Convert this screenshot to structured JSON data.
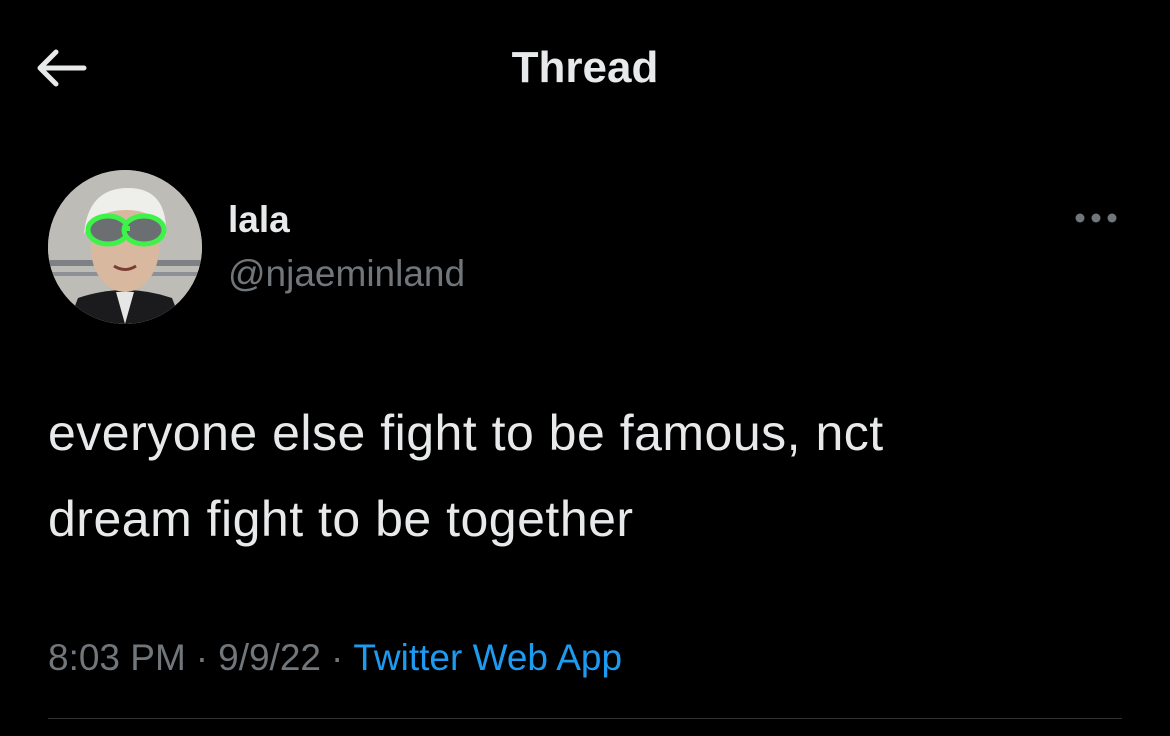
{
  "header": {
    "title": "Thread"
  },
  "tweet": {
    "author_name": "lala",
    "author_handle": "@njaeminland",
    "text_line1": "everyone else fight to be famous, nct",
    "text_line2": "dream fight to be together",
    "time": "8:03 PM",
    "date": "9/9/22",
    "source": "Twitter Web App",
    "separator": "·"
  },
  "icons": {
    "back": "back-arrow-icon",
    "more": "more-horizontal-icon"
  },
  "colors": {
    "background": "#000000",
    "primary_text": "#e7e9ea",
    "secondary_text": "#71767b",
    "link": "#1d9bf0",
    "divider": "#2f3336"
  }
}
